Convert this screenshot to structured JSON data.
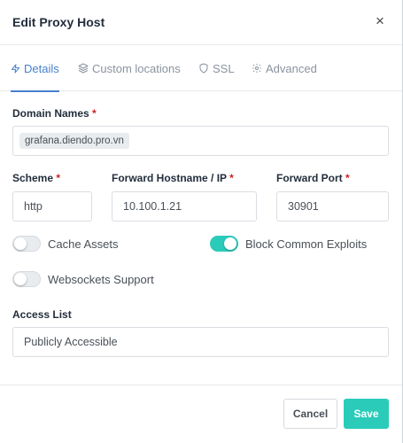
{
  "modal": {
    "title": "Edit Proxy Host",
    "close_glyph": "×"
  },
  "tabs": [
    {
      "label": "Details",
      "icon": "bolt-icon",
      "active": true
    },
    {
      "label": "Custom locations",
      "icon": "layers-icon",
      "active": false
    },
    {
      "label": "SSL",
      "icon": "shield-icon",
      "active": false
    },
    {
      "label": "Advanced",
      "icon": "gear-icon",
      "active": false
    }
  ],
  "form": {
    "domain_names": {
      "label": "Domain Names",
      "required_mark": "*",
      "tags": [
        "grafana.diendo.pro.vn"
      ]
    },
    "scheme": {
      "label": "Scheme",
      "required_mark": "*",
      "value": "http"
    },
    "forward_host": {
      "label": "Forward Hostname / IP",
      "required_mark": "*",
      "value": "10.100.1.21"
    },
    "forward_port": {
      "label": "Forward Port",
      "required_mark": "*",
      "value": "30901"
    },
    "toggles": {
      "cache_assets": {
        "label": "Cache Assets",
        "on": false
      },
      "block_exploits": {
        "label": "Block Common Exploits",
        "on": true
      },
      "websockets": {
        "label": "Websockets Support",
        "on": false
      }
    },
    "access_list": {
      "label": "Access List",
      "value": "Publicly Accessible"
    }
  },
  "footer": {
    "cancel_label": "Cancel",
    "save_label": "Save"
  },
  "colors": {
    "accent_blue": "#467fcf",
    "toggle_on": "#2bcbba",
    "save_button": "#2bcbba",
    "required": "#cd201f"
  }
}
